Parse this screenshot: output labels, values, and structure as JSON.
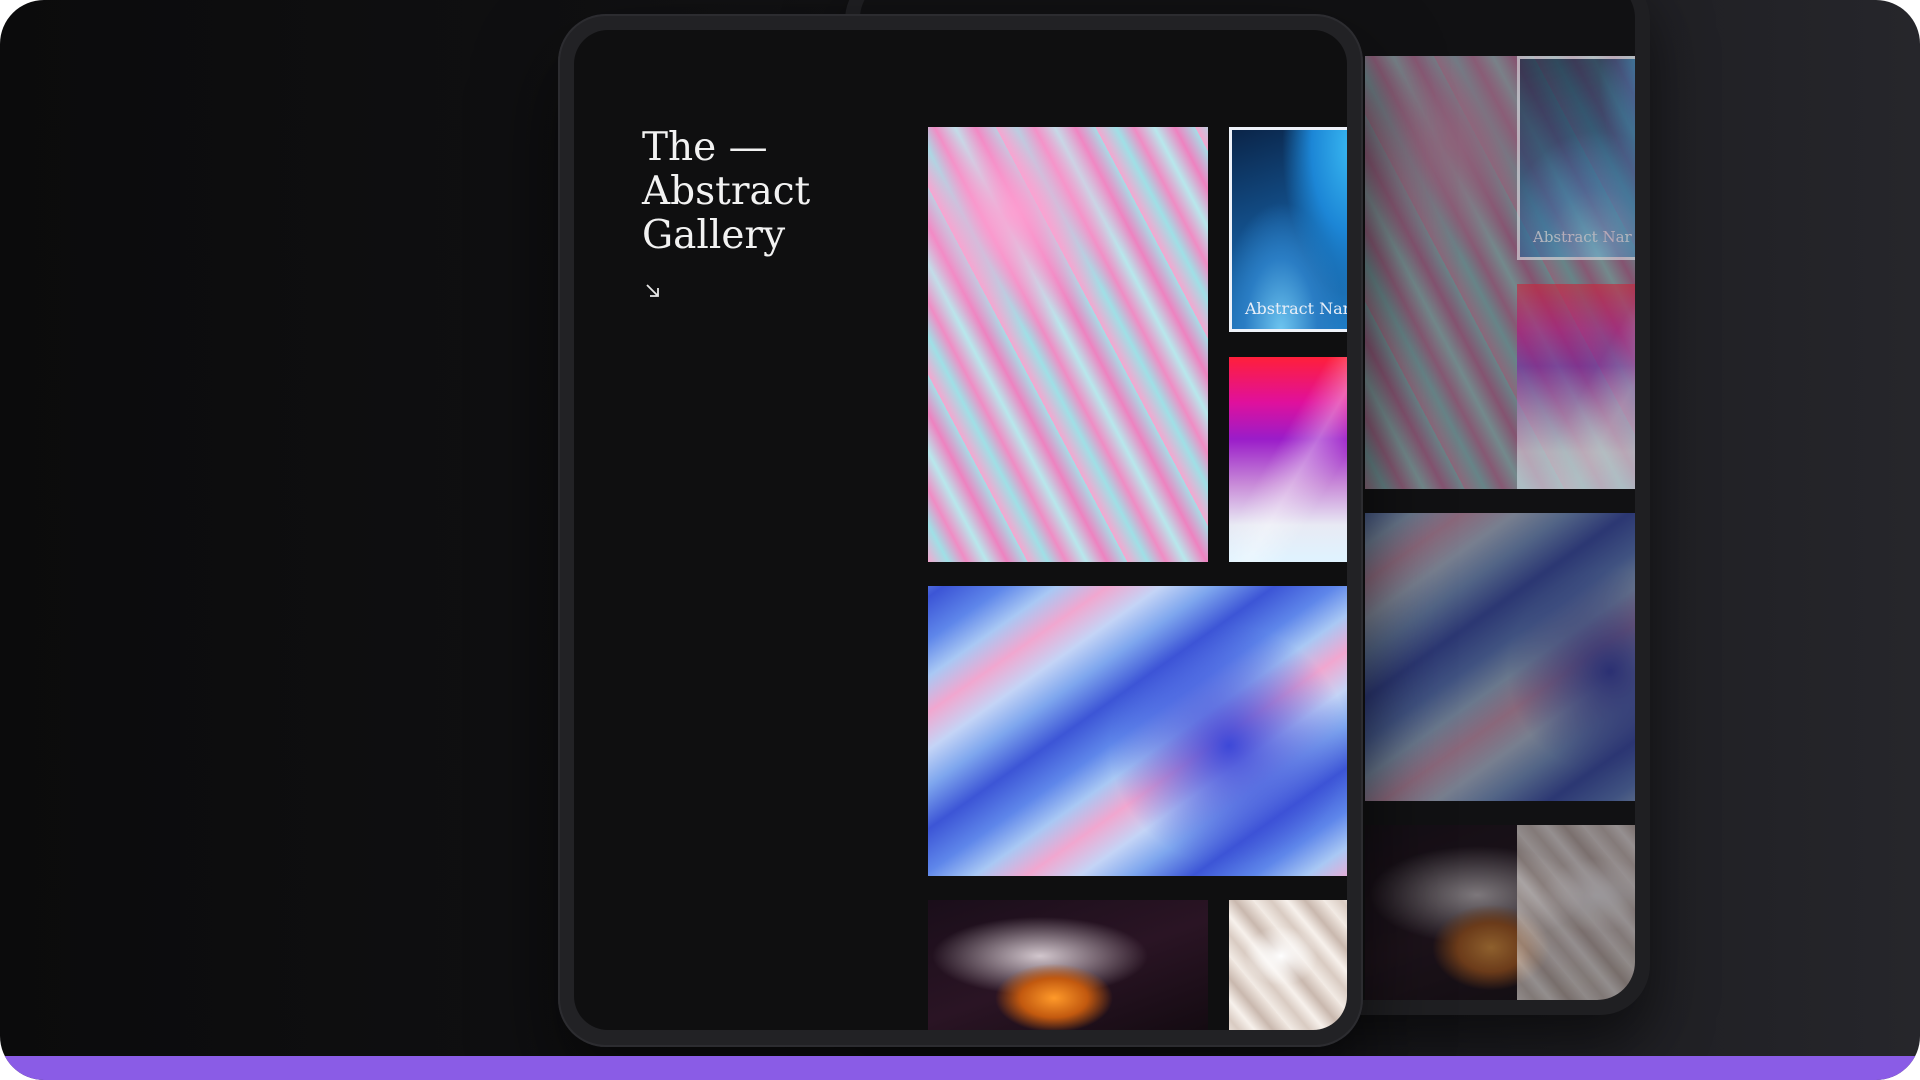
{
  "gallery": {
    "title_lines": [
      "The —",
      "Abstract",
      "Gallery"
    ],
    "arrow_icon": "arrow-down-right-icon",
    "tiles": [
      {
        "id": "pink-marble",
        "art": "pink-cyan-fluid"
      },
      {
        "id": "blue-arch",
        "art": "blue-arch-gradient",
        "caption": "Abstract Nar"
      },
      {
        "id": "rainbow-gradient",
        "art": "red-purple-white-gradient"
      },
      {
        "id": "blue-swirl",
        "art": "blue-pink-fluid"
      },
      {
        "id": "fire-smoke",
        "art": "orange-smoke-on-dark"
      },
      {
        "id": "cream-marble",
        "art": "cream-marble"
      }
    ]
  },
  "colors": {
    "accent_bar": "#8a5ce6",
    "background": "#111113",
    "title_text": "#f2f2f2"
  }
}
